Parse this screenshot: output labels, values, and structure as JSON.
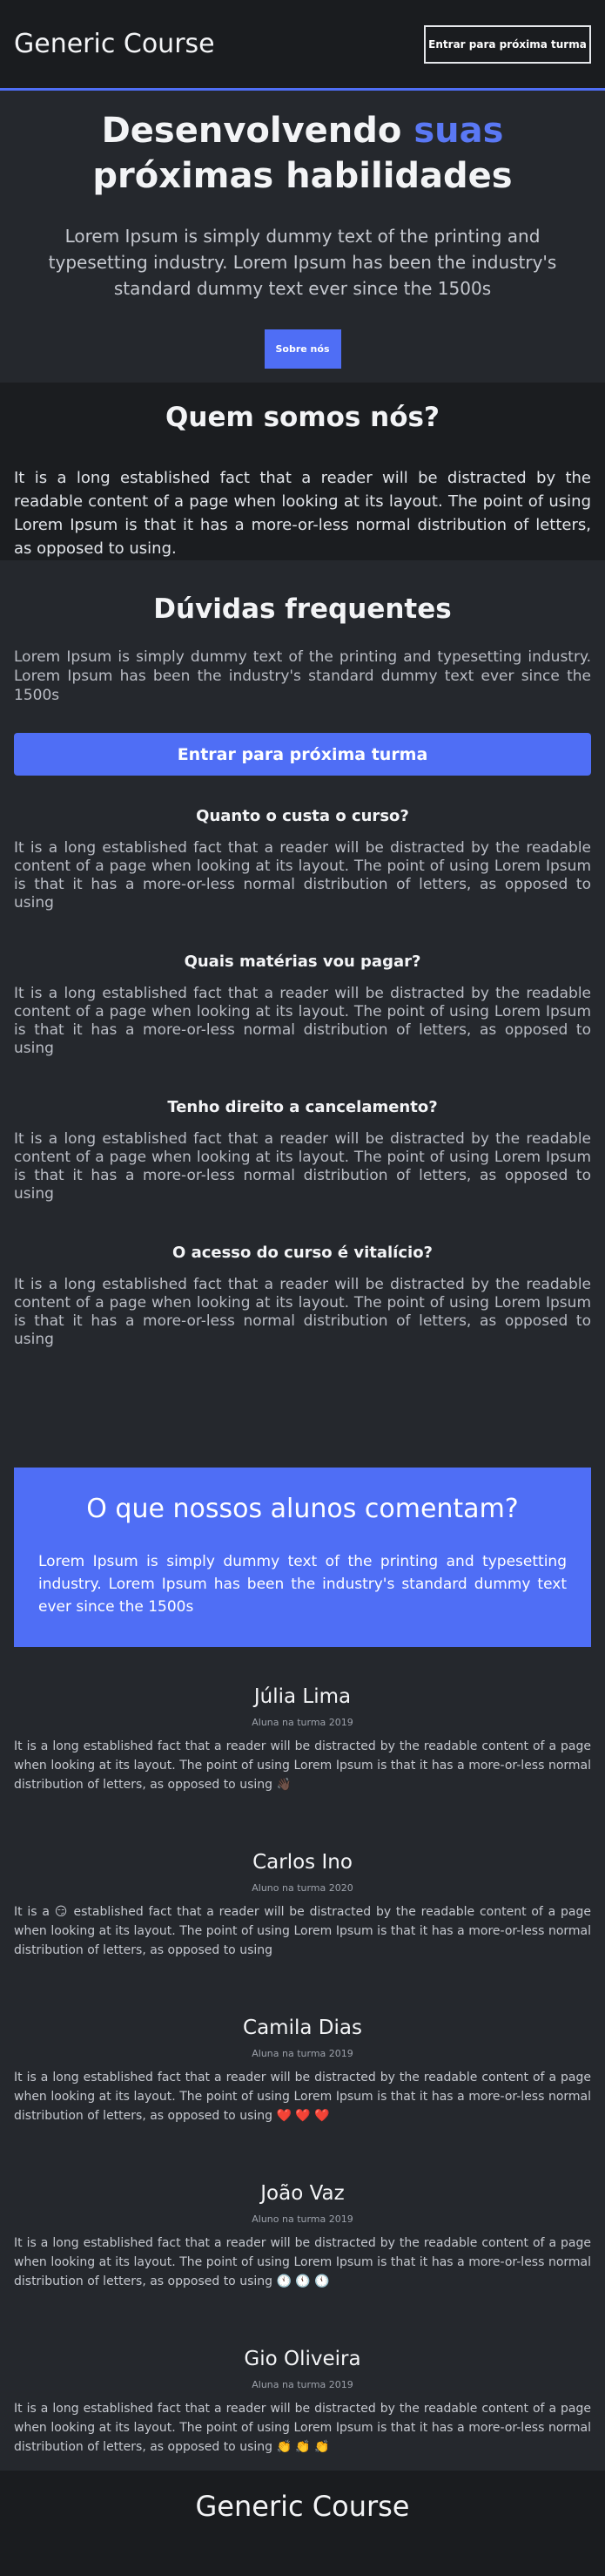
{
  "header": {
    "brand": "Generic Course",
    "cta": "Entrar para próxima turma"
  },
  "hero": {
    "title_before": "Desenvolvendo ",
    "title_accent": "suas",
    "title_after": " próximas habilidades",
    "subtitle": "Lorem Ipsum is simply dummy text of the printing and typesetting industry. Lorem Ipsum has been the industry's standard dummy text ever since the 1500s",
    "button": "Sobre nós"
  },
  "about": {
    "title": "Quem somos nós?",
    "text": "It is a long established fact that a reader will be distracted by the readable content of a page when looking at its layout. The point of using Lorem Ipsum is that it has a more-or-less normal distribution of letters, as opposed to using."
  },
  "faq": {
    "title": "Dúvidas frequentes",
    "intro": "Lorem Ipsum is simply dummy text of the printing and typesetting industry. Lorem Ipsum has been the industry's standard dummy text ever since the 1500s",
    "button": "Entrar para próxima turma",
    "items": [
      {
        "question": "Quanto o custa o curso?",
        "answer": "It is a long established fact that a reader will be distracted by the readable content of a page when looking at its layout. The point of using Lorem Ipsum is that it has a more-or-less normal distribution of letters, as opposed to using"
      },
      {
        "question": "Quais matérias vou pagar?",
        "answer": "It is a long established fact that a reader will be distracted by the readable content of a page when looking at its layout. The point of using Lorem Ipsum is that it has a more-or-less normal distribution of letters, as opposed to using"
      },
      {
        "question": "Tenho direito a cancelamento?",
        "answer": "It is a long established fact that a reader will be distracted by the readable content of a page when looking at its layout. The point of using Lorem Ipsum is that it has a more-or-less normal distribution of letters, as opposed to using"
      },
      {
        "question": "O acesso do curso é vitalício?",
        "answer": "It is a long established fact that a reader will be distracted by the readable content of a page when looking at its layout. The point of using Lorem Ipsum is that it has a more-or-less normal distribution of letters, as opposed to using"
      }
    ]
  },
  "testimonials": {
    "title": "O que nossos alunos comentam?",
    "text": "Lorem Ipsum is simply dummy text of the printing and typesetting industry. Lorem Ipsum has been the industry's standard dummy text ever since the 1500s",
    "reviews": [
      {
        "name": "Júlia Lima",
        "meta": "Aluna na turma 2019",
        "text": "It is a long established fact that a reader will be distracted by the readable content of a page when looking at its layout. The point of using Lorem Ipsum is that it has a more-or-less normal distribution of letters, as opposed to using 👋🏿"
      },
      {
        "name": "Carlos Ino",
        "meta": "Aluno na turma 2020",
        "text": "It is a 😏 established fact that a reader will be distracted by the readable content of a page when looking at its layout. The point of using Lorem Ipsum is that it has a more-or-less normal distribution of letters, as opposed to using"
      },
      {
        "name": "Camila Dias",
        "meta": "Aluna na turma 2019",
        "text": "It is a long established fact that a reader will be distracted by the readable content of a page when looking at its layout. The point of using Lorem Ipsum is that it has a more-or-less normal distribution of letters, as opposed to using ❤️ ❤️ ❤️"
      },
      {
        "name": "João Vaz",
        "meta": "Aluno na turma 2019",
        "text": "It is a long established fact that a reader will be distracted by the readable content of a page when looking at its layout. The point of using Lorem Ipsum is that it has a more-or-less normal distribution of letters, as opposed to using 🕚 🕚 🕚"
      },
      {
        "name": "Gio Oliveira",
        "meta": "Aluna na turma 2019",
        "text": "It is a long established fact that a reader will be distracted by the readable content of a page when looking at its layout. The point of using Lorem Ipsum is that it has a more-or-less normal distribution of letters, as opposed to using 👏 👏 👏"
      }
    ]
  },
  "footer": {
    "brand": "Generic Course"
  },
  "colors": {
    "accent": "#4f6ef5",
    "background": "#202226"
  }
}
